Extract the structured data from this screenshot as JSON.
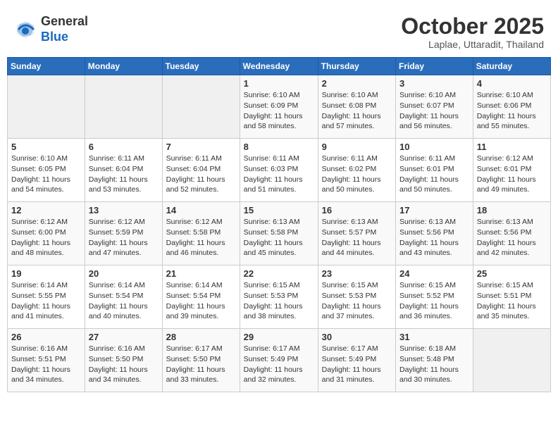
{
  "header": {
    "logo_general": "General",
    "logo_blue": "Blue",
    "month_title": "October 2025",
    "location": "Laplae, Uttaradit, Thailand"
  },
  "weekdays": [
    "Sunday",
    "Monday",
    "Tuesday",
    "Wednesday",
    "Thursday",
    "Friday",
    "Saturday"
  ],
  "weeks": [
    [
      {
        "day": "",
        "sunrise": "",
        "sunset": "",
        "daylight": ""
      },
      {
        "day": "",
        "sunrise": "",
        "sunset": "",
        "daylight": ""
      },
      {
        "day": "",
        "sunrise": "",
        "sunset": "",
        "daylight": ""
      },
      {
        "day": "1",
        "sunrise": "Sunrise: 6:10 AM",
        "sunset": "Sunset: 6:09 PM",
        "daylight": "Daylight: 11 hours and 58 minutes."
      },
      {
        "day": "2",
        "sunrise": "Sunrise: 6:10 AM",
        "sunset": "Sunset: 6:08 PM",
        "daylight": "Daylight: 11 hours and 57 minutes."
      },
      {
        "day": "3",
        "sunrise": "Sunrise: 6:10 AM",
        "sunset": "Sunset: 6:07 PM",
        "daylight": "Daylight: 11 hours and 56 minutes."
      },
      {
        "day": "4",
        "sunrise": "Sunrise: 6:10 AM",
        "sunset": "Sunset: 6:06 PM",
        "daylight": "Daylight: 11 hours and 55 minutes."
      }
    ],
    [
      {
        "day": "5",
        "sunrise": "Sunrise: 6:10 AM",
        "sunset": "Sunset: 6:05 PM",
        "daylight": "Daylight: 11 hours and 54 minutes."
      },
      {
        "day": "6",
        "sunrise": "Sunrise: 6:11 AM",
        "sunset": "Sunset: 6:04 PM",
        "daylight": "Daylight: 11 hours and 53 minutes."
      },
      {
        "day": "7",
        "sunrise": "Sunrise: 6:11 AM",
        "sunset": "Sunset: 6:04 PM",
        "daylight": "Daylight: 11 hours and 52 minutes."
      },
      {
        "day": "8",
        "sunrise": "Sunrise: 6:11 AM",
        "sunset": "Sunset: 6:03 PM",
        "daylight": "Daylight: 11 hours and 51 minutes."
      },
      {
        "day": "9",
        "sunrise": "Sunrise: 6:11 AM",
        "sunset": "Sunset: 6:02 PM",
        "daylight": "Daylight: 11 hours and 50 minutes."
      },
      {
        "day": "10",
        "sunrise": "Sunrise: 6:11 AM",
        "sunset": "Sunset: 6:01 PM",
        "daylight": "Daylight: 11 hours and 50 minutes."
      },
      {
        "day": "11",
        "sunrise": "Sunrise: 6:12 AM",
        "sunset": "Sunset: 6:01 PM",
        "daylight": "Daylight: 11 hours and 49 minutes."
      }
    ],
    [
      {
        "day": "12",
        "sunrise": "Sunrise: 6:12 AM",
        "sunset": "Sunset: 6:00 PM",
        "daylight": "Daylight: 11 hours and 48 minutes."
      },
      {
        "day": "13",
        "sunrise": "Sunrise: 6:12 AM",
        "sunset": "Sunset: 5:59 PM",
        "daylight": "Daylight: 11 hours and 47 minutes."
      },
      {
        "day": "14",
        "sunrise": "Sunrise: 6:12 AM",
        "sunset": "Sunset: 5:58 PM",
        "daylight": "Daylight: 11 hours and 46 minutes."
      },
      {
        "day": "15",
        "sunrise": "Sunrise: 6:13 AM",
        "sunset": "Sunset: 5:58 PM",
        "daylight": "Daylight: 11 hours and 45 minutes."
      },
      {
        "day": "16",
        "sunrise": "Sunrise: 6:13 AM",
        "sunset": "Sunset: 5:57 PM",
        "daylight": "Daylight: 11 hours and 44 minutes."
      },
      {
        "day": "17",
        "sunrise": "Sunrise: 6:13 AM",
        "sunset": "Sunset: 5:56 PM",
        "daylight": "Daylight: 11 hours and 43 minutes."
      },
      {
        "day": "18",
        "sunrise": "Sunrise: 6:13 AM",
        "sunset": "Sunset: 5:56 PM",
        "daylight": "Daylight: 11 hours and 42 minutes."
      }
    ],
    [
      {
        "day": "19",
        "sunrise": "Sunrise: 6:14 AM",
        "sunset": "Sunset: 5:55 PM",
        "daylight": "Daylight: 11 hours and 41 minutes."
      },
      {
        "day": "20",
        "sunrise": "Sunrise: 6:14 AM",
        "sunset": "Sunset: 5:54 PM",
        "daylight": "Daylight: 11 hours and 40 minutes."
      },
      {
        "day": "21",
        "sunrise": "Sunrise: 6:14 AM",
        "sunset": "Sunset: 5:54 PM",
        "daylight": "Daylight: 11 hours and 39 minutes."
      },
      {
        "day": "22",
        "sunrise": "Sunrise: 6:15 AM",
        "sunset": "Sunset: 5:53 PM",
        "daylight": "Daylight: 11 hours and 38 minutes."
      },
      {
        "day": "23",
        "sunrise": "Sunrise: 6:15 AM",
        "sunset": "Sunset: 5:53 PM",
        "daylight": "Daylight: 11 hours and 37 minutes."
      },
      {
        "day": "24",
        "sunrise": "Sunrise: 6:15 AM",
        "sunset": "Sunset: 5:52 PM",
        "daylight": "Daylight: 11 hours and 36 minutes."
      },
      {
        "day": "25",
        "sunrise": "Sunrise: 6:15 AM",
        "sunset": "Sunset: 5:51 PM",
        "daylight": "Daylight: 11 hours and 35 minutes."
      }
    ],
    [
      {
        "day": "26",
        "sunrise": "Sunrise: 6:16 AM",
        "sunset": "Sunset: 5:51 PM",
        "daylight": "Daylight: 11 hours and 34 minutes."
      },
      {
        "day": "27",
        "sunrise": "Sunrise: 6:16 AM",
        "sunset": "Sunset: 5:50 PM",
        "daylight": "Daylight: 11 hours and 34 minutes."
      },
      {
        "day": "28",
        "sunrise": "Sunrise: 6:17 AM",
        "sunset": "Sunset: 5:50 PM",
        "daylight": "Daylight: 11 hours and 33 minutes."
      },
      {
        "day": "29",
        "sunrise": "Sunrise: 6:17 AM",
        "sunset": "Sunset: 5:49 PM",
        "daylight": "Daylight: 11 hours and 32 minutes."
      },
      {
        "day": "30",
        "sunrise": "Sunrise: 6:17 AM",
        "sunset": "Sunset: 5:49 PM",
        "daylight": "Daylight: 11 hours and 31 minutes."
      },
      {
        "day": "31",
        "sunrise": "Sunrise: 6:18 AM",
        "sunset": "Sunset: 5:48 PM",
        "daylight": "Daylight: 11 hours and 30 minutes."
      },
      {
        "day": "",
        "sunrise": "",
        "sunset": "",
        "daylight": ""
      }
    ]
  ]
}
